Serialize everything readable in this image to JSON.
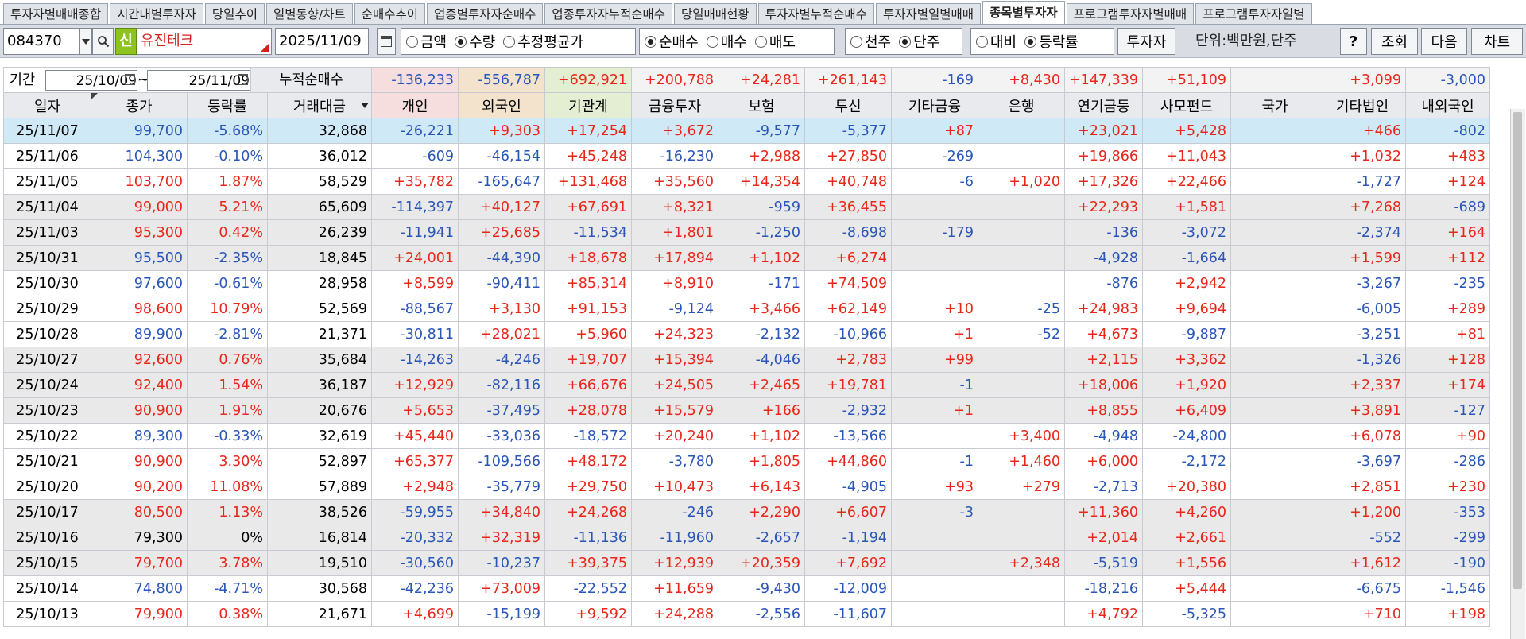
{
  "tabs": [
    "투자자별매매종합",
    "시간대별투자자",
    "당일추이",
    "일별동향/차트",
    "순매수추이",
    "업종별투자자순매수",
    "업종투자자누적순매수",
    "당일매매현황",
    "투자자별누적순매수",
    "투자자별일별매매",
    "종목별투자자",
    "프로그램투자자별매매",
    "프로그램투자자일별"
  ],
  "active_tab_index": 10,
  "toolbar": {
    "stock_code": "084370",
    "new_badge": "신",
    "stock_name": "유진테크",
    "date": "2025/11/09",
    "amount_group": [
      "금액",
      "수량",
      "추정평균가"
    ],
    "amount_selected": 1,
    "trade_group": [
      "순매수",
      "매수",
      "매도"
    ],
    "trade_selected": 0,
    "unit_scale_group": [
      "천주",
      "단주"
    ],
    "unit_scale_selected": 1,
    "compare_group": [
      "대비",
      "등락률"
    ],
    "compare_selected": 1,
    "investor_button": "투자자",
    "unit_label": "단위:백만원,단주",
    "help_button": "?",
    "query_button": "조회",
    "next_button": "다음",
    "chart_button": "차트"
  },
  "period": {
    "label": "기간",
    "from": "25/10/09",
    "tilde": "~",
    "to": "25/11/09",
    "cum_label": "누적순매수"
  },
  "summary": [
    "-136,233",
    "-556,787",
    "+692,921",
    "+200,788",
    "+24,281",
    "+261,143",
    "-169",
    "+8,430",
    "+147,339",
    "+51,109",
    "",
    "+3,099",
    "-3,000"
  ],
  "headers": [
    "일자",
    "종가",
    "등락률",
    "거래대금",
    "개인",
    "외국인",
    "기관계",
    "금융투자",
    "보험",
    "투신",
    "기타금융",
    "은행",
    "연기금등",
    "사모펀드",
    "국가",
    "기타법인",
    "내외국인"
  ],
  "rows": [
    [
      "25/11/07",
      "99,700",
      "-5.68%",
      "32,868",
      "-26,221",
      "+9,303",
      "+17,254",
      "+3,672",
      "-9,577",
      "-5,377",
      "+87",
      "",
      "+23,021",
      "+5,428",
      "",
      "+466",
      "-802"
    ],
    [
      "25/11/06",
      "104,300",
      "-0.10%",
      "36,012",
      "-609",
      "-46,154",
      "+45,248",
      "-16,230",
      "+2,988",
      "+27,850",
      "-269",
      "",
      "+19,866",
      "+11,043",
      "",
      "+1,032",
      "+483"
    ],
    [
      "25/11/05",
      "103,700",
      "1.87%",
      "58,529",
      "+35,782",
      "-165,647",
      "+131,468",
      "+35,560",
      "+14,354",
      "+40,748",
      "-6",
      "+1,020",
      "+17,326",
      "+22,466",
      "",
      "-1,727",
      "+124"
    ],
    [
      "25/11/04",
      "99,000",
      "5.21%",
      "65,609",
      "-114,397",
      "+40,127",
      "+67,691",
      "+8,321",
      "-959",
      "+36,455",
      "",
      "",
      "+22,293",
      "+1,581",
      "",
      "+7,268",
      "-689"
    ],
    [
      "25/11/03",
      "95,300",
      "0.42%",
      "26,239",
      "-11,941",
      "+25,685",
      "-11,534",
      "+1,801",
      "-1,250",
      "-8,698",
      "-179",
      "",
      "-136",
      "-3,072",
      "",
      "-2,374",
      "+164"
    ],
    [
      "25/10/31",
      "95,500",
      "-2.35%",
      "18,845",
      "+24,001",
      "-44,390",
      "+18,678",
      "+17,894",
      "+1,102",
      "+6,274",
      "",
      "",
      "-4,928",
      "-1,664",
      "",
      "+1,599",
      "+112"
    ],
    [
      "25/10/30",
      "97,600",
      "-0.61%",
      "28,958",
      "+8,599",
      "-90,411",
      "+85,314",
      "+8,910",
      "-171",
      "+74,509",
      "",
      "",
      "-876",
      "+2,942",
      "",
      "-3,267",
      "-235"
    ],
    [
      "25/10/29",
      "98,600",
      "10.79%",
      "52,569",
      "-88,567",
      "+3,130",
      "+91,153",
      "-9,124",
      "+3,466",
      "+62,149",
      "+10",
      "-25",
      "+24,983",
      "+9,694",
      "",
      "-6,005",
      "+289"
    ],
    [
      "25/10/28",
      "89,900",
      "-2.81%",
      "21,371",
      "-30,811",
      "+28,021",
      "+5,960",
      "+24,323",
      "-2,132",
      "-10,966",
      "+1",
      "-52",
      "+4,673",
      "-9,887",
      "",
      "-3,251",
      "+81"
    ],
    [
      "25/10/27",
      "92,600",
      "0.76%",
      "35,684",
      "-14,263",
      "-4,246",
      "+19,707",
      "+15,394",
      "-4,046",
      "+2,783",
      "+99",
      "",
      "+2,115",
      "+3,362",
      "",
      "-1,326",
      "+128"
    ],
    [
      "25/10/24",
      "92,400",
      "1.54%",
      "36,187",
      "+12,929",
      "-82,116",
      "+66,676",
      "+24,505",
      "+2,465",
      "+19,781",
      "-1",
      "",
      "+18,006",
      "+1,920",
      "",
      "+2,337",
      "+174"
    ],
    [
      "25/10/23",
      "90,900",
      "1.91%",
      "20,676",
      "+5,653",
      "-37,495",
      "+28,078",
      "+15,579",
      "+166",
      "-2,932",
      "+1",
      "",
      "+8,855",
      "+6,409",
      "",
      "+3,891",
      "-127"
    ],
    [
      "25/10/22",
      "89,300",
      "-0.33%",
      "32,619",
      "+45,440",
      "-33,036",
      "-18,572",
      "+20,240",
      "+1,102",
      "-13,566",
      "",
      "+3,400",
      "-4,948",
      "-24,800",
      "",
      "+6,078",
      "+90"
    ],
    [
      "25/10/21",
      "90,900",
      "3.30%",
      "52,897",
      "+65,377",
      "-109,566",
      "+48,172",
      "-3,780",
      "+1,805",
      "+44,860",
      "-1",
      "+1,460",
      "+6,000",
      "-2,172",
      "",
      "-3,697",
      "-286"
    ],
    [
      "25/10/20",
      "90,200",
      "11.08%",
      "57,889",
      "+2,948",
      "-35,779",
      "+29,750",
      "+10,473",
      "+6,143",
      "-4,905",
      "+93",
      "+279",
      "-2,713",
      "+20,380",
      "",
      "+2,851",
      "+230"
    ],
    [
      "25/10/17",
      "80,500",
      "1.13%",
      "38,526",
      "-59,955",
      "+34,840",
      "+24,268",
      "-246",
      "+2,290",
      "+6,607",
      "-3",
      "",
      "+11,360",
      "+4,260",
      "",
      "+1,200",
      "-353"
    ],
    [
      "25/10/16",
      "79,300",
      "0%",
      "16,814",
      "-20,332",
      "+32,319",
      "-11,136",
      "-11,960",
      "-2,657",
      "-1,194",
      "",
      "",
      "+2,014",
      "+2,661",
      "",
      "-552",
      "-299"
    ],
    [
      "25/10/15",
      "79,700",
      "3.78%",
      "19,510",
      "-30,560",
      "-10,237",
      "+39,375",
      "+12,939",
      "+20,359",
      "+7,692",
      "",
      "+2,348",
      "-5,519",
      "+1,556",
      "",
      "+1,612",
      "-190"
    ],
    [
      "25/10/14",
      "74,800",
      "-4.71%",
      "30,568",
      "-42,236",
      "+73,009",
      "-22,552",
      "+11,659",
      "-9,430",
      "-12,009",
      "",
      "",
      "-18,216",
      "+5,444",
      "",
      "-6,675",
      "-1,546"
    ],
    [
      "25/10/13",
      "79,900",
      "0.38%",
      "21,671",
      "+4,699",
      "-15,199",
      "+9,592",
      "+24,288",
      "-2,556",
      "-11,607",
      "",
      "",
      "+4,792",
      "-5,325",
      "",
      "+710",
      "+198"
    ]
  ],
  "row_shading": [
    "selected",
    "white",
    "white",
    "gray",
    "gray",
    "gray",
    "white",
    "white",
    "white",
    "gray",
    "gray",
    "gray",
    "white",
    "white",
    "white",
    "gray",
    "gray",
    "gray",
    "white",
    "white"
  ],
  "colors": {
    "red": "#e8271a",
    "blue": "#2a56b8",
    "selected": "#cfe9f6",
    "gray": "#e9e9e9"
  }
}
